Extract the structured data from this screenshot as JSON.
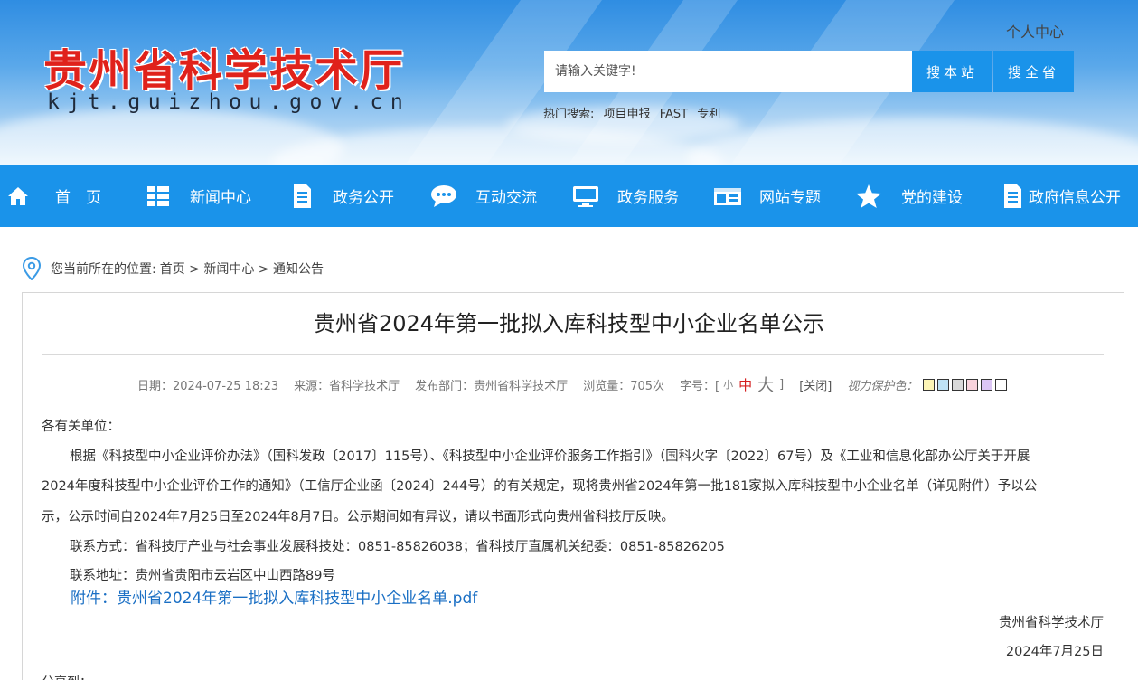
{
  "header": {
    "logo_cn": "贵州省科学技术厅",
    "logo_en": "kjt.guizhou.gov.cn",
    "personal_center": "个人中心",
    "search_placeholder": "请输入关键字!",
    "btn_search_site": "搜本站",
    "btn_search_province": "搜全省",
    "hot_label": "热门搜索:",
    "hot_terms": [
      "项目申报",
      "FAST",
      "专利"
    ]
  },
  "nav": {
    "items": [
      {
        "label": "首　页",
        "icon": "home-icon"
      },
      {
        "label": "新闻中心",
        "icon": "list-icon"
      },
      {
        "label": "政务公开",
        "icon": "document-icon"
      },
      {
        "label": "互动交流",
        "icon": "chat-icon"
      },
      {
        "label": "政务服务",
        "icon": "monitor-icon"
      },
      {
        "label": "网站专题",
        "icon": "window-icon"
      },
      {
        "label": "党的建设",
        "icon": "star-icon"
      },
      {
        "label": "政府信息公开",
        "icon": "document-icon"
      }
    ]
  },
  "breadcrumb": {
    "prefix": "您当前所在的位置:",
    "path": "首页 > 新闻中心 > 通知公告"
  },
  "article": {
    "title": "贵州省2024年第一批拟入库科技型中小企业名单公示",
    "date": "日期：2024-07-25 18:23",
    "source": "来源：省科学技术厅",
    "department": "发布部门：贵州省科学技术厅",
    "views": "浏览量：705次",
    "font_label": "字号：[",
    "font_small": "小",
    "font_medium": "中",
    "font_large": "大",
    "font_close_bracket": "]",
    "close_link": "[关闭]",
    "eye_protect_label": "视力保护色：",
    "swatches": [
      "#fdf5b6",
      "#bfe3f5",
      "#d9d9d9",
      "#f8d3dc",
      "#dcc6f5",
      "#ffffff"
    ],
    "greeting": "各有关单位：",
    "para1_line1": "根据《科技型中小企业评价办法》（国科发政〔2017〕115号）、《科技型中小企业评价服务工作指引》（国科火字〔2022〕67号）及《工业和信息化部办公厅关于开展",
    "para1_line2": "2024年度科技型中小企业评价工作的通知》（工信厅企业函〔2024〕244号）的有关规定，现将贵州省2024年第一批181家拟入库科技型中小企业名单（详见附件）予以公",
    "para1_line3": "示，公示时间自2024年7月25日至2024年8月7日。公示期间如有异议，请以书面形式向贵州省科技厅反映。",
    "contact": "联系方式：省科技厅产业与社会事业发展科技处：0851-85826038；省科技厅直属机关纪委：0851-85826205",
    "address": "联系地址：贵州省贵阳市云岩区中山西路89号",
    "attachment": "附件：贵州省2024年第一批拟入库科技型中小企业名单.pdf",
    "sign_org": "贵州省科学技术厅",
    "sign_date": "2024年7月25日",
    "share": "分享到："
  }
}
